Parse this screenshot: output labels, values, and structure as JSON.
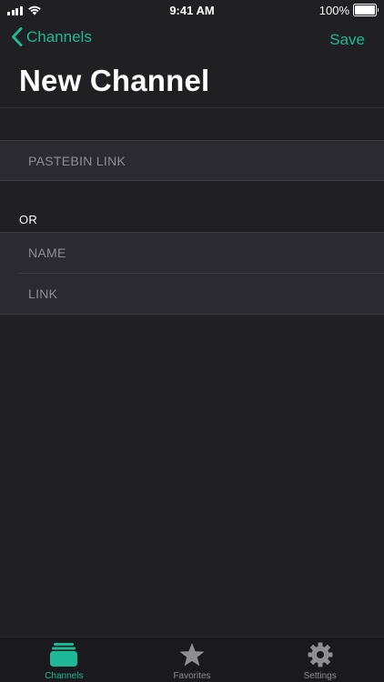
{
  "status_bar": {
    "time": "9:41 AM",
    "battery_text": "100%"
  },
  "nav": {
    "back_label": "Channels",
    "save_label": "Save",
    "title": "New Channel"
  },
  "form": {
    "pastebin": {
      "placeholder": "PASTEBIN LINK",
      "value": ""
    },
    "section_label": "OR",
    "name": {
      "placeholder": "NAME",
      "value": ""
    },
    "link": {
      "placeholder": "LINK",
      "value": ""
    }
  },
  "tab_bar": {
    "tabs": [
      {
        "label": "Channels",
        "icon": "channels-icon",
        "active": true
      },
      {
        "label": "Favorites",
        "icon": "star-icon",
        "active": false
      },
      {
        "label": "Settings",
        "icon": "gear-icon",
        "active": false
      }
    ]
  },
  "colors": {
    "accent": "#1fb896",
    "background": "#1f1f24",
    "field_background": "#2a2a30",
    "inactive_tab": "#8e8e93"
  }
}
